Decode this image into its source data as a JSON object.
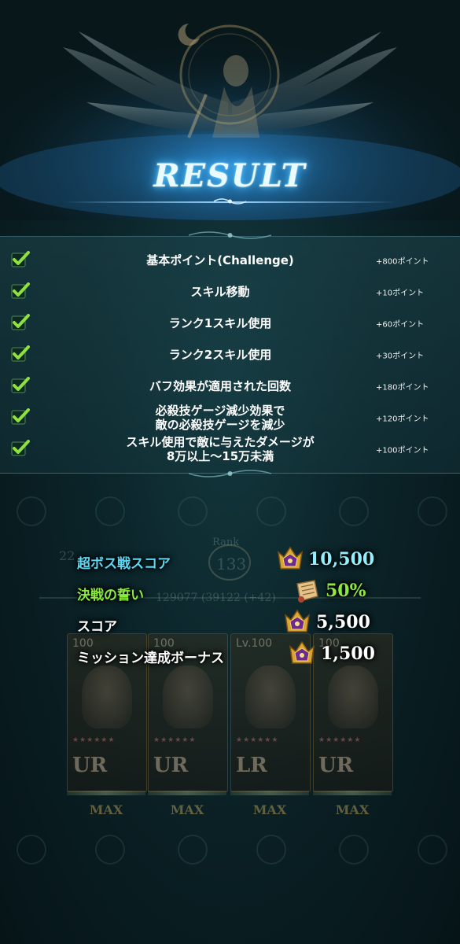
{
  "title": "RESULT",
  "missions": [
    {
      "label": "基本ポイント(Challenge)",
      "points": "+800ポイント"
    },
    {
      "label": "スキル移動",
      "points": "+10ポイント"
    },
    {
      "label": "ランク1スキル使用",
      "points": "+60ポイント"
    },
    {
      "label": "ランク2スキル使用",
      "points": "+30ポイント"
    },
    {
      "label": "バフ効果が適用された回数",
      "points": "+180ポイント"
    },
    {
      "label_line1": "必殺技ゲージ減少効果で",
      "label_line2": "敵の必殺技ゲージを減少",
      "points": "+120ポイント"
    },
    {
      "label_line1": "スキル使用で敵に与えたダメージが",
      "label_line2": "8万以上〜15万未満",
      "points": "+100ポイント"
    }
  ],
  "scores": {
    "boss_label": "超ボス戦スコア",
    "boss_value": "10,500",
    "boss_label_color": "#5fd6f2",
    "boss_value_color": "#8ff0ff",
    "oath_label": "決戦の誓い",
    "oath_value": "50%",
    "oath_color": "#8bea3e",
    "score_label": "スコア",
    "score_value": "5,500",
    "bonus_label": "ミッション達成ボーナス",
    "bonus_value": "1,500"
  },
  "background": {
    "rank_label": "Rank",
    "rank_value": "133",
    "stat_left": "22",
    "stat_line": "129077 (39122 (+42)",
    "cards": [
      {
        "level": "100",
        "rarity": "UR",
        "status": "MAX"
      },
      {
        "level": "100",
        "rarity": "UR",
        "status": "MAX"
      },
      {
        "level": "Lv.100",
        "rarity": "LR",
        "status": "MAX"
      },
      {
        "level": "100",
        "rarity": "UR",
        "status": "MAX"
      }
    ]
  },
  "icons": [
    "check-icon",
    "crown-badge-icon",
    "scroll-icon"
  ],
  "colors": {
    "accent_glow": "#2ba6ff",
    "check_green": "#7ed13a"
  }
}
